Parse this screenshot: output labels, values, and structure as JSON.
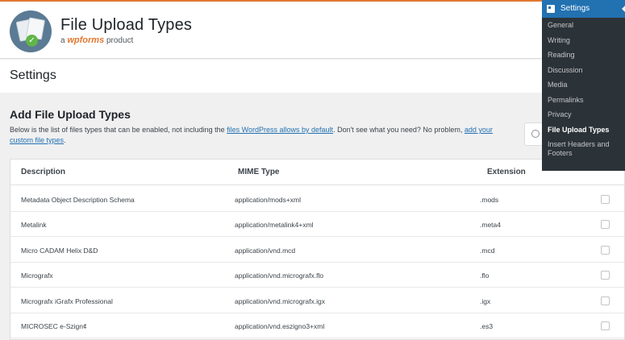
{
  "plugin": {
    "title": "File Upload Types",
    "subtitle_prefix": "a ",
    "brand": "wpforms",
    "subtitle_suffix": " product"
  },
  "settings_heading": "Settings",
  "section": {
    "title": "Add File Upload Types",
    "desc_1": "Below is the list of files types that can be enabled, not including the ",
    "link_1": "files WordPress allows by default",
    "desc_2": ". Don't see what you need? No problem, ",
    "link_2": "add your custom file types",
    "desc_3": "."
  },
  "search": {
    "icon": "search-icon"
  },
  "table": {
    "headers": {
      "description": "Description",
      "mime": "MIME Type",
      "extension": "Extension"
    },
    "rows": [
      {
        "description": "Metadata Object Description Schema",
        "mime": "application/mods+xml",
        "extension": ".mods",
        "checked": false
      },
      {
        "description": "Metalink",
        "mime": "application/metalink4+xml",
        "extension": ".meta4",
        "checked": false
      },
      {
        "description": "Micro CADAM Helix D&D",
        "mime": "application/vnd.mcd",
        "extension": ".mcd",
        "checked": false
      },
      {
        "description": "Micrografx",
        "mime": "application/vnd.micrografx.flo",
        "extension": ".flo",
        "checked": false
      },
      {
        "description": "Micrografx iGrafx Professional",
        "mime": "application/vnd.micrografx.igx",
        "extension": ".igx",
        "checked": false
      },
      {
        "description": "MICROSEC e-Szign¢",
        "mime": "application/vnd.eszigno3+xml",
        "extension": ".es3",
        "checked": false
      }
    ]
  },
  "admin_menu": {
    "title": "Settings",
    "items": [
      {
        "label": "General"
      },
      {
        "label": "Writing"
      },
      {
        "label": "Reading"
      },
      {
        "label": "Discussion"
      },
      {
        "label": "Media"
      },
      {
        "label": "Permalinks"
      },
      {
        "label": "Privacy"
      },
      {
        "label": "File Upload Types"
      },
      {
        "label": "Insert Headers and Footers"
      }
    ],
    "active_index": 7
  }
}
